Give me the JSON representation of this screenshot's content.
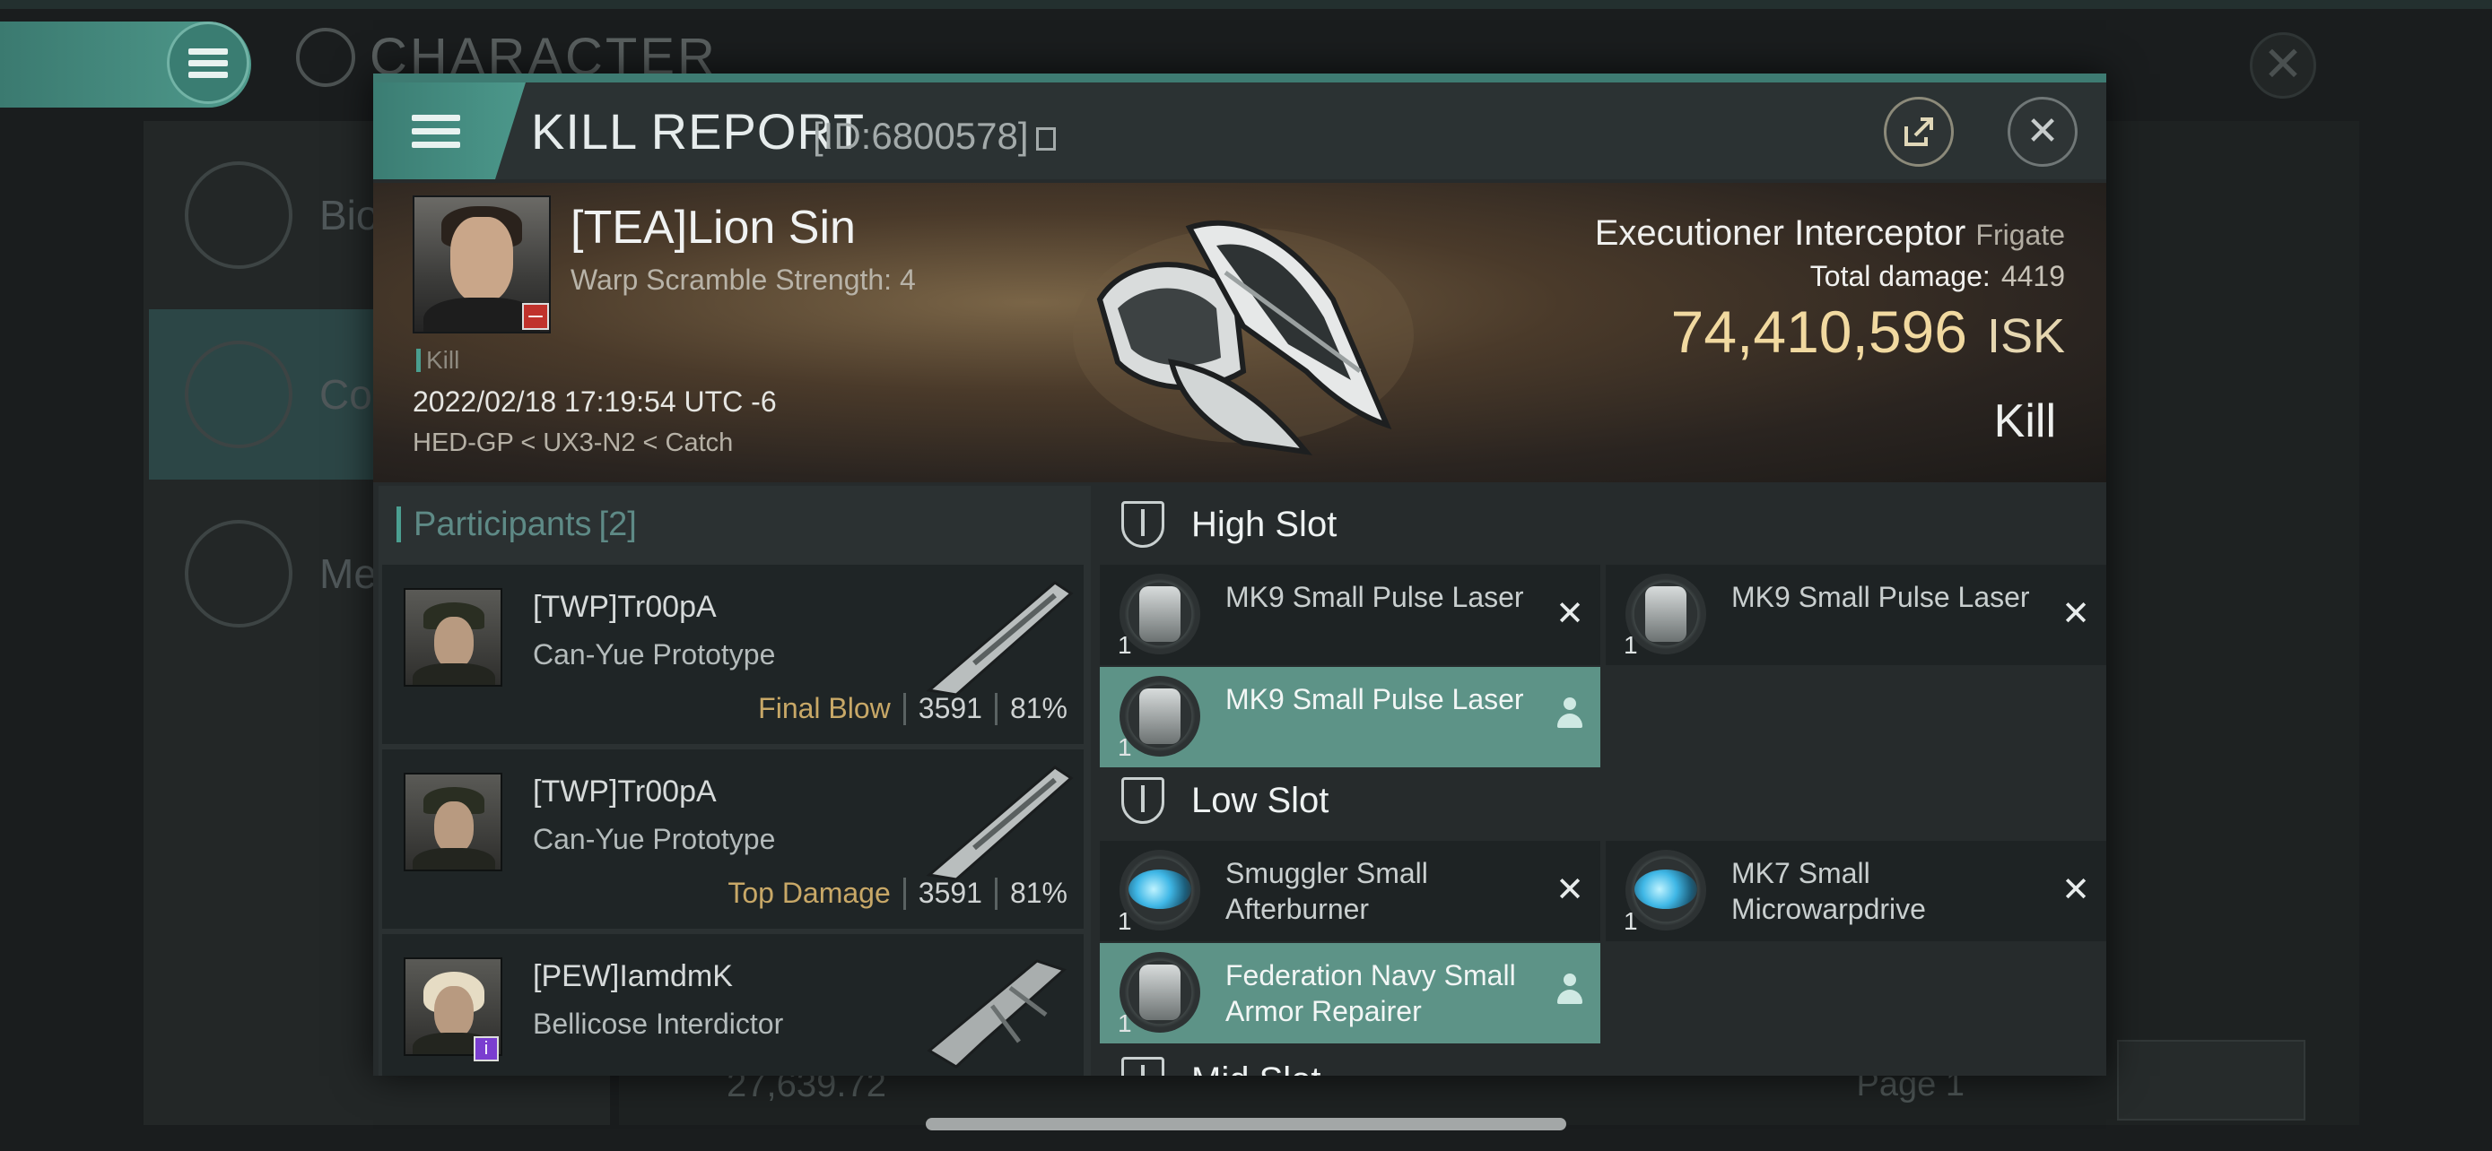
{
  "background": {
    "screen_title": "CHARACTER",
    "nav_items": [
      {
        "label": "Bio"
      },
      {
        "label": "Cor"
      },
      {
        "label": "Me"
      }
    ],
    "footer_amount": "27,639.72",
    "page_label": "Page 1"
  },
  "header": {
    "title": "KILL REPORT",
    "report_id": "[ID:6800578]"
  },
  "victim": {
    "name": "[TEA]Lion Sin",
    "warp_scramble": "Warp Scramble Strength: 4",
    "kill_tag": "Kill",
    "datetime": "2022/02/18 17:19:54 UTC -6",
    "location": "HED-GP < UX3-N2 < Catch",
    "ship_name": "Executioner Interceptor",
    "ship_class": "Frigate",
    "total_damage_label": "Total damage:",
    "total_damage_value": "4419",
    "isk_value": "74,410,596",
    "isk_unit": "ISK",
    "result": "Kill"
  },
  "participants": {
    "label": "Participants",
    "count": "[2]",
    "rows": [
      {
        "name": "[TWP]Tr00pA",
        "ship": "Can-Yue Prototype",
        "tag": "Final Blow",
        "damage": "3591",
        "percent": "81%"
      },
      {
        "name": "[TWP]Tr00pA",
        "ship": "Can-Yue Prototype",
        "tag": "Top Damage",
        "damage": "3591",
        "percent": "81%"
      },
      {
        "name": "[PEW]IamdmK",
        "ship": "Bellicose Interdictor",
        "tag": "",
        "damage": "",
        "percent": ""
      }
    ]
  },
  "slots": {
    "high_label": "High Slot",
    "low_label": "Low Slot",
    "mid_label": "Mid Slot",
    "high": [
      {
        "name": "MK9 Small Pulse Laser",
        "qty": "1",
        "status": "destroyed"
      },
      {
        "name": "MK9 Small Pulse Laser",
        "qty": "1",
        "status": "destroyed"
      },
      {
        "name": "MK9 Small Pulse Laser",
        "qty": "1",
        "status": "dropped"
      }
    ],
    "low": [
      {
        "name": "Smuggler Small Afterburner",
        "qty": "1",
        "status": "destroyed"
      },
      {
        "name": "MK7 Small Microwarpdrive",
        "qty": "1",
        "status": "destroyed"
      },
      {
        "name": "Federation Navy Small Armor Repairer",
        "qty": "1",
        "status": "dropped"
      }
    ]
  },
  "colors": {
    "accent": "#4c988b",
    "isk": "#f1d9a0",
    "final_blow": "#c8a867",
    "dropped_item": "#5d9387"
  }
}
